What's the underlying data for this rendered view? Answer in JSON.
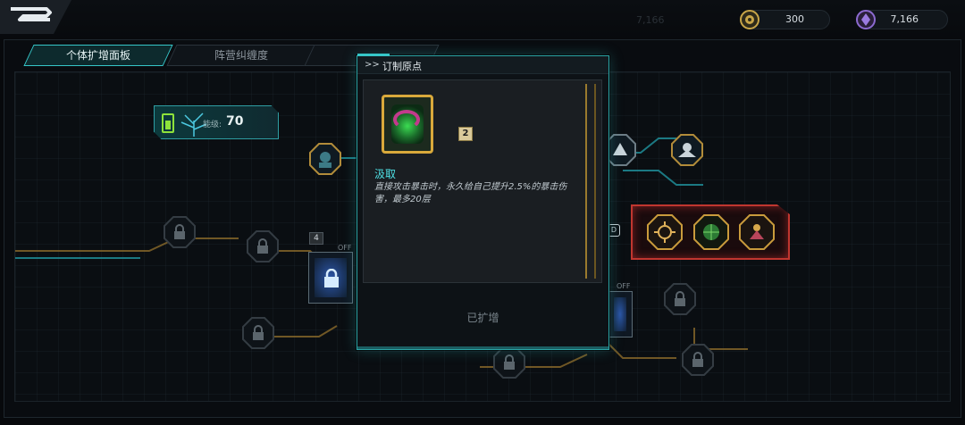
{
  "topbar": {
    "back_icon": "back-arrow-icon",
    "currencies": [
      {
        "icon": "gear-coin-icon",
        "value": "300"
      },
      {
        "icon": "purple-gem-icon",
        "value": "7,166"
      }
    ],
    "ghost_value": "7,166"
  },
  "tabs": [
    {
      "label": "个体扩增面板",
      "active": true
    },
    {
      "label": "阵营纠缠度",
      "active": false
    },
    {
      "label": "",
      "active": false
    }
  ],
  "energy": {
    "label": "能级:",
    "value": "70"
  },
  "board": {
    "badge_value": "4",
    "off_label": "OFF"
  },
  "popup": {
    "arrows": ">>",
    "title": "订制原点",
    "level_badge": "2",
    "skill_name": "汲取",
    "skill_desc": "直接攻击暴击时，永久给自己提升2.5%的暴击伤害，最多20层",
    "status": "已扩增"
  },
  "colors": {
    "accent": "#36c6c8",
    "gold": "#d9a93b",
    "red": "#c0362f"
  }
}
